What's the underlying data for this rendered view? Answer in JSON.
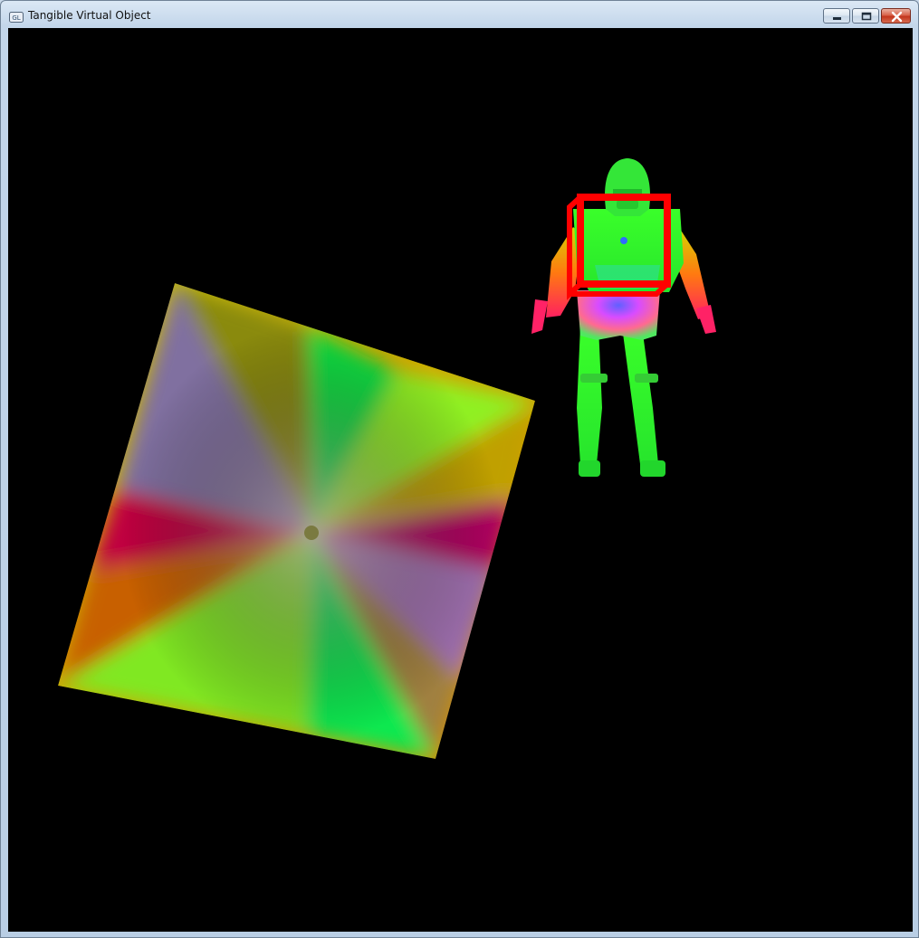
{
  "window": {
    "title": "Tangible Virtual Object",
    "icon": "opengl-window-icon",
    "controls": {
      "minimize_icon": "minimize-icon",
      "maximize_icon": "maximize-icon",
      "close_icon": "close-icon"
    }
  },
  "scene": {
    "background_color": "#000000",
    "objects": [
      {
        "name": "textured-plane",
        "shading": "normal-color rainbow gradient"
      },
      {
        "name": "trooper-figure",
        "shading": "normal-color, mostly green"
      },
      {
        "name": "tracking-box",
        "color": "#ff0000"
      }
    ]
  }
}
